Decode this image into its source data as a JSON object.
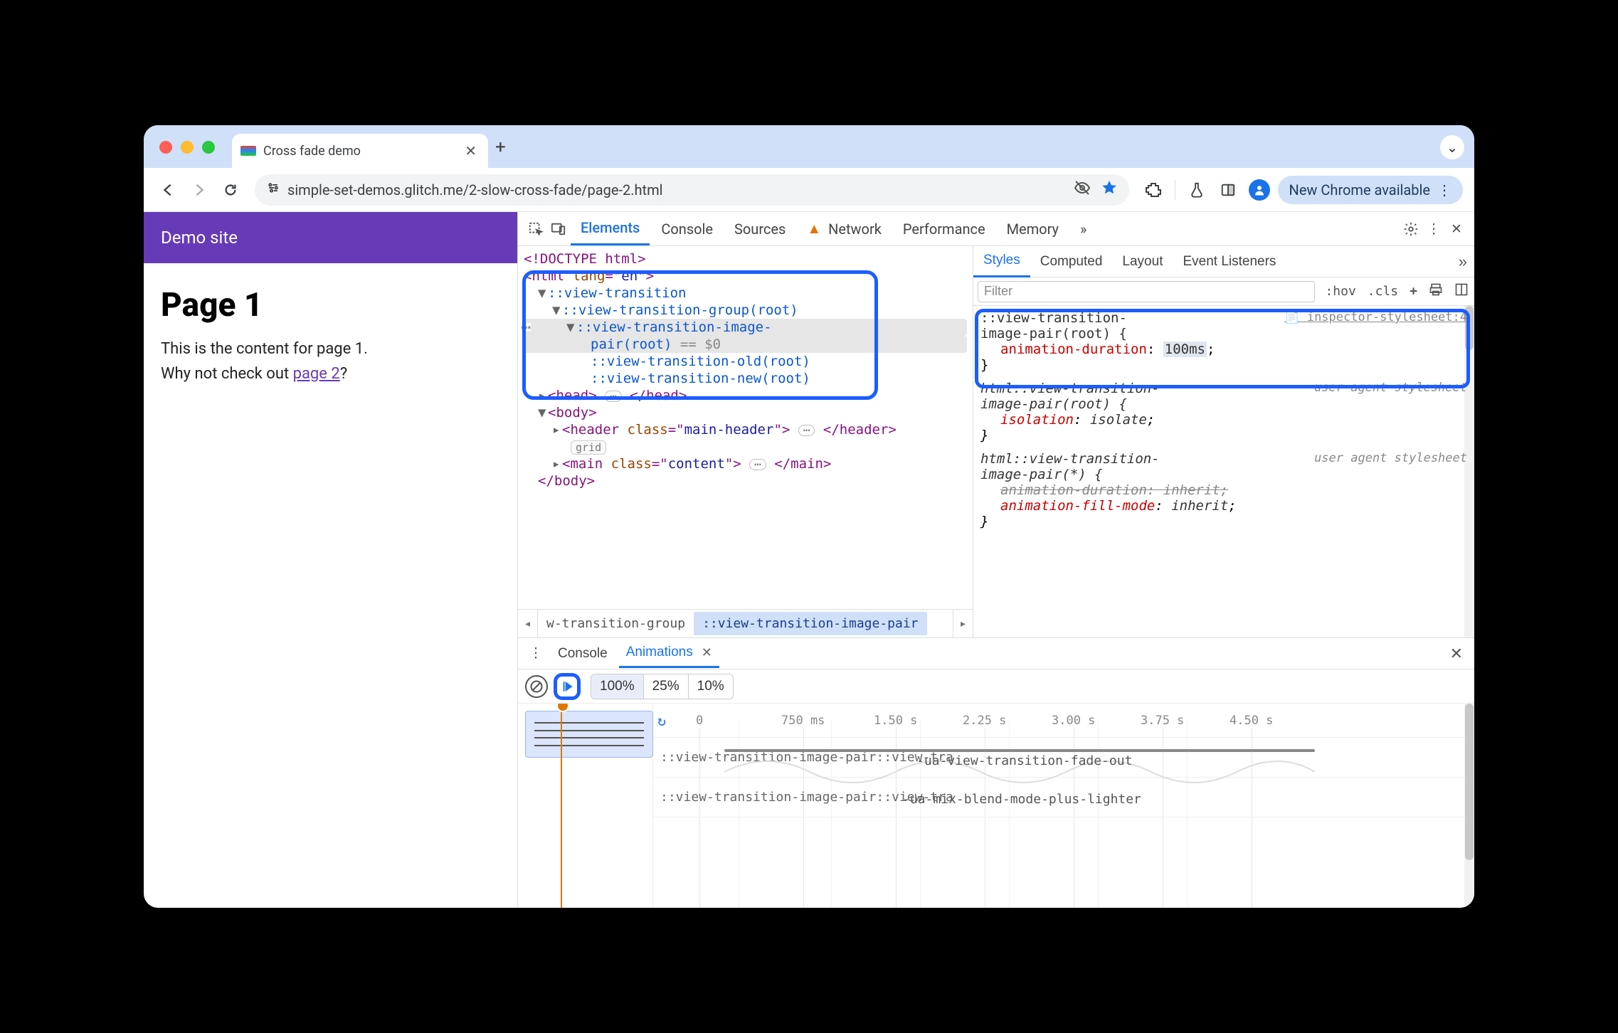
{
  "tab": {
    "title": "Cross fade demo"
  },
  "chevron_label": "⌄",
  "url": "simple-set-demos.glitch.me/2-slow-cross-fade/page-2.html",
  "nav": {
    "back": "←",
    "forward": "→",
    "reload": "⟳"
  },
  "toolbar_icons": [
    "eye-off-icon",
    "star-icon",
    "puzzle-icon",
    "flask-icon",
    "panel-icon",
    "avatar-icon"
  ],
  "update_pill": "New Chrome available",
  "page": {
    "header": "Demo site",
    "h1": "Page 1",
    "p1": "This is the content for page 1.",
    "p2_prefix": "Why not check out ",
    "p2_link": "page 2",
    "p2_suffix": "?"
  },
  "devtools": {
    "tabs": [
      "Elements",
      "Console",
      "Sources",
      "Network",
      "Performance",
      "Memory"
    ],
    "network_warning": true,
    "overflow": "»",
    "tree": {
      "doctype": "<!DOCTYPE html>",
      "html_open": "<html lang=\"en\">",
      "vt": "::view-transition",
      "vtg": "::view-transition-group(root)",
      "vtip_a": "::view-transition-image-",
      "vtip_b": "pair(root)",
      "sel_eq": " == $0",
      "vto": "::view-transition-old(root)",
      "vtn": "::view-transition-new(root)",
      "head": "<head> … </head>",
      "body": "<body>",
      "header": "<header class=\"main-header\"> … </header>",
      "grid_badge": "grid",
      "main": "<main class=\"content\"> … </main>",
      "body_close": "</body>"
    },
    "breadcrumb": {
      "left": "w-transition-group",
      "active": "::view-transition-image-pair"
    }
  },
  "styles": {
    "tabs": [
      "Styles",
      "Computed",
      "Layout",
      "Event Listeners"
    ],
    "filter_placeholder": "Filter",
    "tbtns": [
      ":hov",
      ".cls",
      "+"
    ],
    "rules": [
      {
        "selector": "::view-transition-image-pair(root) {",
        "source": "inspector-stylesheet:4",
        "source_kind": "link",
        "props": [
          {
            "name": "animation-duration",
            "value": "100ms",
            "ed": true
          }
        ],
        "close": "}"
      },
      {
        "selector": "html::view-transition-image-pair(root) {",
        "source": "user agent stylesheet",
        "source_kind": "uas",
        "italic": true,
        "props": [
          {
            "name": "isolation",
            "value": "isolate"
          }
        ],
        "close": "}"
      },
      {
        "selector": "html::view-transition-image-pair(*) {",
        "source": "user agent stylesheet",
        "source_kind": "uas",
        "italic": true,
        "props": [
          {
            "name": "animation-duration",
            "value": "inherit",
            "strike": true
          },
          {
            "name": "animation-fill-mode",
            "value": "inherit"
          }
        ],
        "close": "}"
      }
    ]
  },
  "drawer": {
    "tabs": [
      "Console",
      "Animations"
    ],
    "speeds": [
      "100%",
      "25%",
      "10%"
    ],
    "timeline_ticks": [
      "0",
      "750 ms",
      "1.50 s",
      "2.25 s",
      "3.00 s",
      "3.75 s",
      "4.50 s"
    ],
    "tracks": [
      {
        "label": "::view-transition-image-pair::view-tra",
        "anim": "-ua-view-transition-fade-out"
      },
      {
        "label": "::view-transition-image-pair::view-tra",
        "anim": "-ua-mix-blend-mode-plus-lighter"
      }
    ]
  }
}
